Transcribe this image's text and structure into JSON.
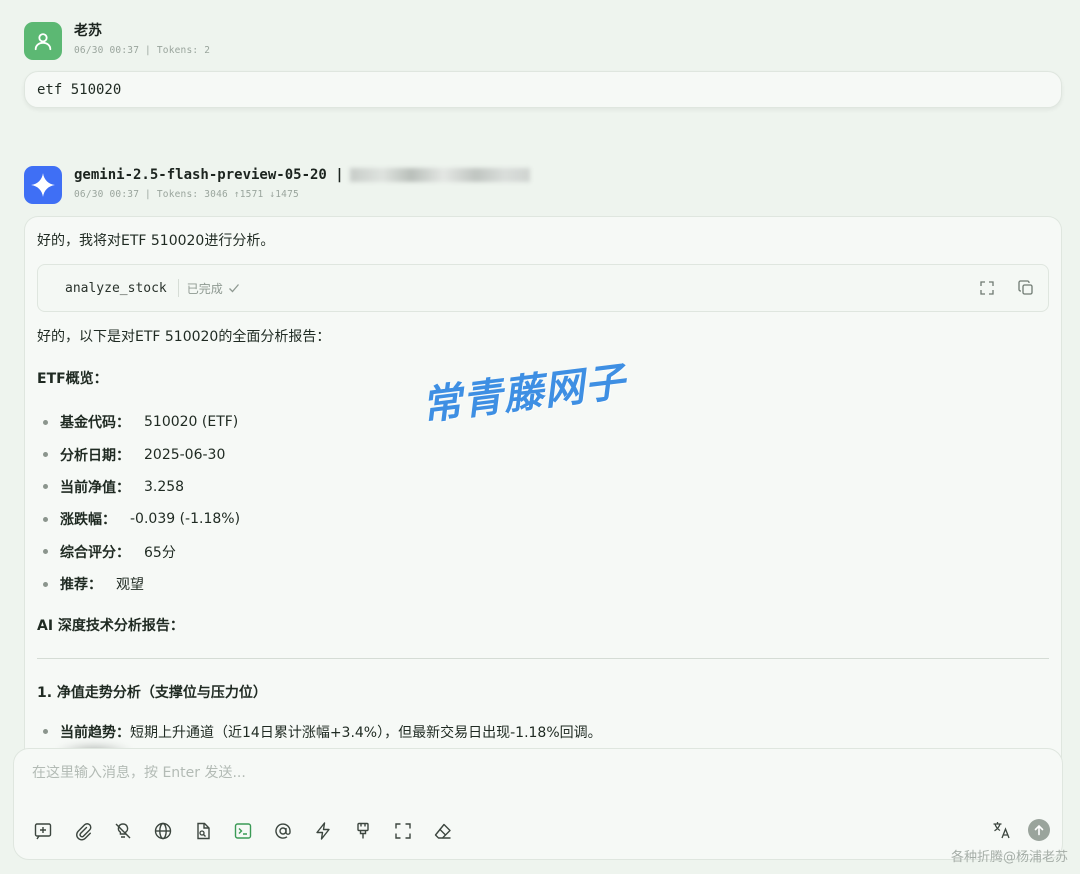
{
  "user_message": {
    "name": "老苏",
    "meta": "06/30 00:37 | Tokens: 2",
    "text": "etf 510020"
  },
  "bot_message": {
    "model": "gemini-2.5-flash-preview-05-20 |",
    "meta": "06/30 00:37 | Tokens: 3046 ↑1571 ↓1475",
    "intro": "好的，我将对ETF 510020进行分析。",
    "tool_call": {
      "name": "analyze_stock",
      "status": "已完成"
    },
    "report_intro": "好的，以下是对ETF 510020的全面分析报告：",
    "overview_title": "ETF概览：",
    "overview_items": [
      {
        "label": "基金代码：",
        "value": "510020 (ETF)"
      },
      {
        "label": "分析日期：",
        "value": "2025-06-30"
      },
      {
        "label": "当前净值：",
        "value": "3.258"
      },
      {
        "label": "涨跌幅：",
        "value": "-0.039 (-1.18%)"
      },
      {
        "label": "综合评分：",
        "value": "65分"
      },
      {
        "label": "推荐：",
        "value": "观望"
      }
    ],
    "ai_report_title": "AI 深度技术分析报告：",
    "section1_title": "1. 净值走势分析（支撑位与压力位）",
    "section1_items": [
      {
        "label": "当前趋势：",
        "value": "短期上升通道（近14日累计涨幅+3.4%），但最新交易日出现-1.18%回调。"
      }
    ]
  },
  "watermark": "常青藤网子",
  "composer": {
    "placeholder": "在这里输入消息，按 Enter 发送..."
  },
  "footer": "各种折腾@杨浦老苏",
  "icons": {
    "toolbar": [
      "new-topic-icon",
      "attachment-icon",
      "no-thinking-icon",
      "web-search-icon",
      "knowledge-icon",
      "mcp-terminal-icon",
      "mention-icon",
      "quick-phrase-icon",
      "clear-brush-icon",
      "fullscreen-icon",
      "eraser-icon"
    ],
    "right": [
      "translate-icon",
      "send-icon"
    ]
  },
  "colors": {
    "user_avatar": "#5cb873",
    "bot_avatar": "#3f6ff5",
    "background": "#eef4ee",
    "watermark": "#3e8fe3",
    "mcp_icon": "#3a9a55"
  }
}
